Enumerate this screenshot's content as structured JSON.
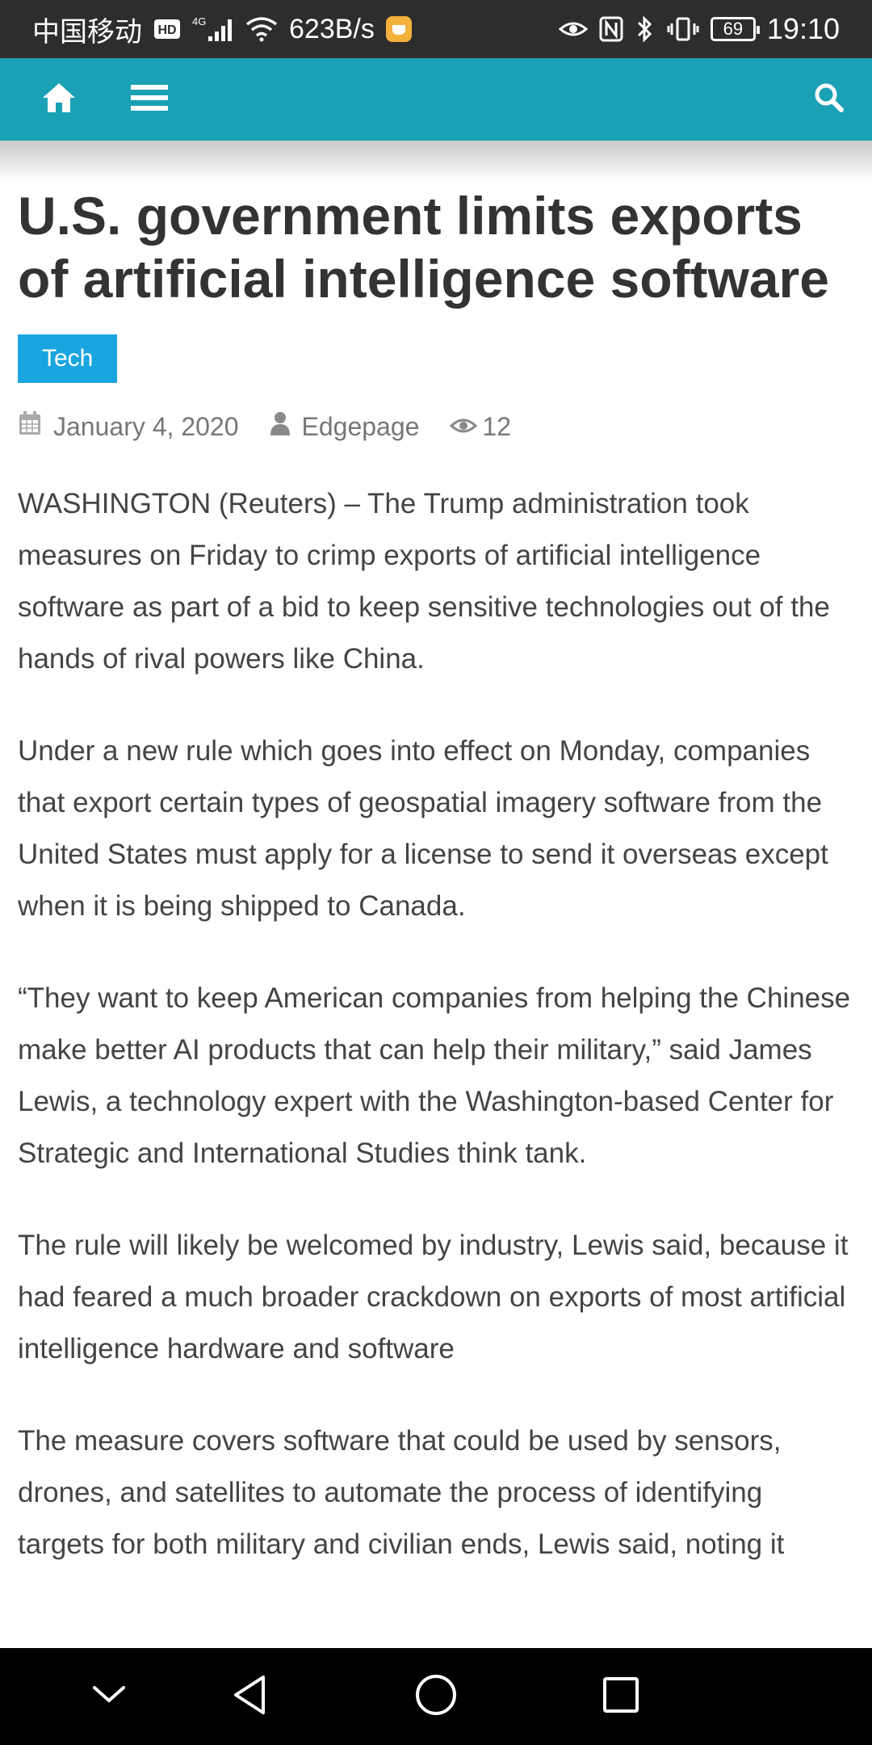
{
  "status_bar": {
    "carrier": "中国移动",
    "hd": "HD",
    "network": "4G",
    "speed": "623B/s",
    "battery": "69",
    "time": "19:10"
  },
  "nav": {
    "icons": [
      "home-icon",
      "menu-icon",
      "search-icon"
    ],
    "color": "#1aa1b5"
  },
  "article": {
    "title": "U.S. government limits exports of artificial intelligence software",
    "category": "Tech",
    "category_color": "#1aa5e0",
    "date": "January 4, 2020",
    "author": "Edgepage",
    "views": "12",
    "paragraphs": [
      "WASHINGTON (Reuters) – The Trump administration took measures on Friday to crimp exports of artificial intelligence software as part of a bid to keep sensitive technologies out of the hands of rival powers like China.",
      "Under a new rule which goes into effect on Monday, companies that export certain types of geospatial imagery software from the United States must apply for a license to send it overseas except when it is being shipped to Canada.",
      "“They want to keep American companies from helping the Chinese make better AI products that can help their military,” said James Lewis, a technology expert with the Washington-based Center for Strategic and International Studies think tank.",
      "The rule will likely be welcomed by industry, Lewis said, because it had feared a much broader crackdown on exports of most artificial intelligence hardware and software",
      "The measure covers software that could be used by sensors, drones, and satellites to automate the process of identifying targets for both military and civilian ends, Lewis said, noting it"
    ]
  },
  "system_nav": {
    "icons": [
      "chevron-down-icon",
      "back-icon",
      "home-circle-icon",
      "recent-apps-icon"
    ]
  }
}
